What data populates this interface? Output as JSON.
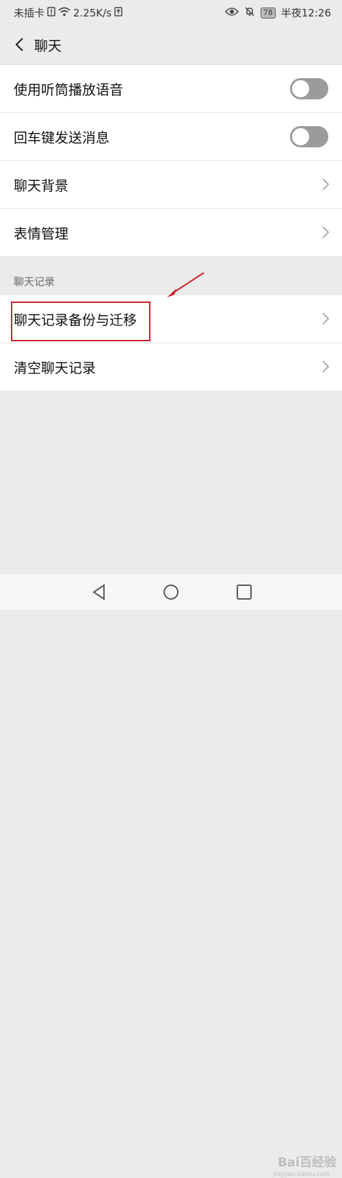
{
  "status_bar": {
    "carrier": "未插卡",
    "speed": "2.25K/s",
    "battery": "78",
    "time": "半夜12:26"
  },
  "header": {
    "title": "聊天"
  },
  "settings": {
    "group1": [
      {
        "label": "使用听筒播放语音",
        "control": "toggle",
        "on": false
      },
      {
        "label": "回车键发送消息",
        "control": "toggle",
        "on": false
      },
      {
        "label": "聊天背景",
        "control": "chevron"
      },
      {
        "label": "表情管理",
        "control": "chevron"
      }
    ],
    "section_header": "聊天记录",
    "group2": [
      {
        "label": "聊天记录备份与迁移",
        "control": "chevron"
      },
      {
        "label": "清空聊天记录",
        "control": "chevron"
      }
    ]
  },
  "colors": {
    "accent": "#c8202a",
    "toggle_off": "#9b9b9b",
    "background": "#ebebeb"
  },
  "watermark": {
    "main": "Bai百经验",
    "sub": "jingyan.baidu.com"
  }
}
